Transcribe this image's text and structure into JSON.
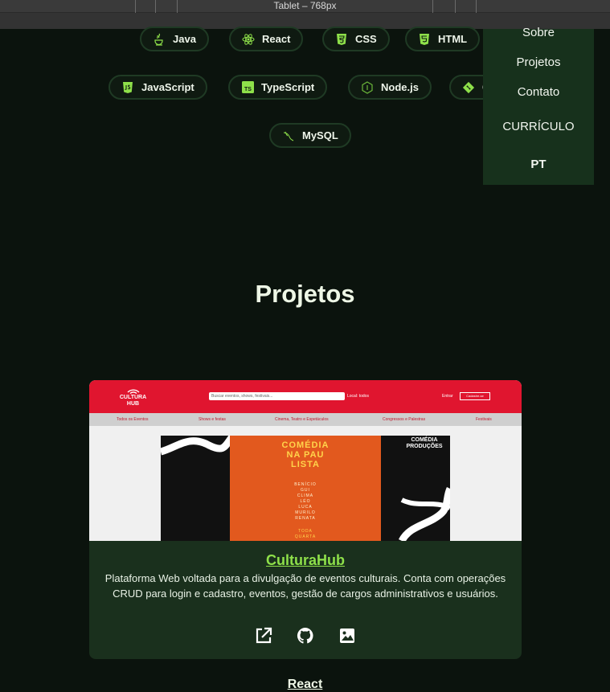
{
  "devtools": {
    "device_label": "Tablet – 768px"
  },
  "skills": [
    {
      "label": "Java",
      "icon": "java-icon"
    },
    {
      "label": "React",
      "icon": "react-icon"
    },
    {
      "label": "CSS",
      "icon": "css3-icon"
    },
    {
      "label": "HTML",
      "icon": "html5-icon"
    },
    {
      "label": "JavaScript",
      "icon": "javascript-icon"
    },
    {
      "label": "TypeScript",
      "icon": "typescript-icon"
    },
    {
      "label": "Node.js",
      "icon": "nodejs-icon"
    },
    {
      "label": "G",
      "icon": "git-icon"
    },
    {
      "label": "MySQL",
      "icon": "mysql-icon"
    }
  ],
  "menu": {
    "items": [
      "Sobre",
      "Projetos",
      "Contato"
    ],
    "resume": "CURRÍCULO",
    "language": "PT"
  },
  "projects_section": {
    "title": "Projetos"
  },
  "project": {
    "title": "CulturaHub",
    "description": "Plataforma Web voltada para a divulgação de eventos culturais. Conta com operações CRUD para login e cadastro, eventos, gestão de cargos administrativos e usuários.",
    "actions": [
      "external-link-icon",
      "github-icon",
      "image-icon"
    ],
    "screenshot": {
      "logo_line1": "CULTURA",
      "logo_line2": "HUB",
      "search_placeholder": "Buscar eventos, shows, festivais...",
      "location": "Local: todos",
      "login": "Entrar",
      "signup": "Cadastre-se",
      "categories": [
        "Todos os Eventos",
        "Shows e festas",
        "Cinema, Teatro e Espetáculos",
        "Congressos e Palestras",
        "Festivais"
      ],
      "banner_title_1": "COMÉDIA",
      "banner_title_2": "NA PAU",
      "banner_title_3": "LISTA",
      "banner_names": [
        "BENÍCIO",
        "GUI",
        "CLIMA",
        "LÉO",
        "LUCA",
        "MURILO",
        "RENATA"
      ],
      "banner_footer_1": "TODA",
      "banner_footer_2": "QUARTA",
      "producer_1": "COMÉDIA",
      "producer_2": "PRODUÇÕES"
    }
  },
  "next_section": {
    "title": "React"
  },
  "colors": {
    "background": "#0b130d",
    "accent": "#8ee04a",
    "card": "#1a301d",
    "menu": "#17311c"
  }
}
